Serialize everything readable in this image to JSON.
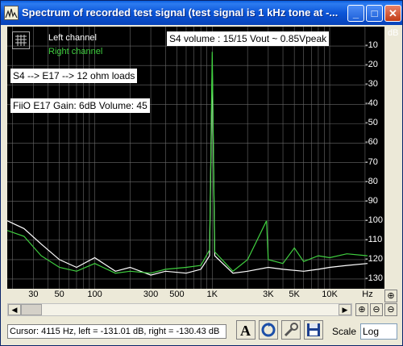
{
  "window": {
    "title": "Spectrum of recorded test signal (test signal is 1 kHz tone at -...",
    "minimize_glyph": "_",
    "maximize_glyph": "□",
    "close_glyph": "✕"
  },
  "legend": {
    "left": "Left channel",
    "right": "Right channel"
  },
  "annotations": {
    "volume": "S4 volume :     15/15     Vout ~ 0.85Vpeak",
    "chain": "S4 --> E17 --> 12 ohm loads",
    "settings": "FiiO E17   Gain: 6dB   Volume: 45"
  },
  "y_unit": "dB",
  "x_unit": "Hz",
  "status": {
    "cursor": "Cursor:  4115 Hz,  left = -131.01 dB,  right = -130.43 dB"
  },
  "scale": {
    "label": "Scale",
    "value": "Log"
  },
  "tool_icons": [
    "text-tool-icon",
    "refresh-icon",
    "wrench-icon",
    "save-disk-icon"
  ],
  "colors": {
    "left": "#ffffff",
    "right": "#40d040",
    "background": "#000000",
    "grid": "#6a6a6a"
  },
  "chart_data": {
    "type": "line",
    "x_scale": "log",
    "x_ticks": [
      "30",
      "50",
      "100",
      "300",
      "500",
      "1K",
      "3K",
      "5K",
      "10K",
      "Hz"
    ],
    "y_ticks": [
      "dB",
      "-10",
      "-20",
      "-30",
      "-40",
      "-50",
      "-60",
      "-70",
      "-80",
      "-90",
      "-100",
      "-110",
      "-120",
      "-130"
    ],
    "ylim": [
      -135,
      0
    ],
    "xlim": [
      18,
      21000
    ],
    "series": [
      {
        "name": "Left channel",
        "color": "#ffffff",
        "points": [
          [
            18,
            -100
          ],
          [
            25,
            -104
          ],
          [
            35,
            -112
          ],
          [
            50,
            -120
          ],
          [
            70,
            -124
          ],
          [
            100,
            -119
          ],
          [
            150,
            -126
          ],
          [
            200,
            -124
          ],
          [
            300,
            -128
          ],
          [
            400,
            -126
          ],
          [
            600,
            -127
          ],
          [
            800,
            -125
          ],
          [
            950,
            -118
          ],
          [
            1000,
            -20
          ],
          [
            1050,
            -118
          ],
          [
            1500,
            -127
          ],
          [
            2000,
            -126
          ],
          [
            3000,
            -124
          ],
          [
            4000,
            -125
          ],
          [
            6000,
            -126
          ],
          [
            8000,
            -125
          ],
          [
            10000,
            -124
          ],
          [
            14000,
            -123
          ],
          [
            21000,
            -122
          ]
        ]
      },
      {
        "name": "Right channel",
        "color": "#40d040",
        "points": [
          [
            18,
            -105
          ],
          [
            25,
            -108
          ],
          [
            35,
            -118
          ],
          [
            50,
            -124
          ],
          [
            70,
            -126
          ],
          [
            100,
            -122
          ],
          [
            150,
            -127
          ],
          [
            200,
            -126
          ],
          [
            300,
            -127
          ],
          [
            400,
            -125
          ],
          [
            600,
            -124
          ],
          [
            800,
            -123
          ],
          [
            950,
            -115
          ],
          [
            1000,
            -13
          ],
          [
            1050,
            -116
          ],
          [
            1500,
            -126
          ],
          [
            2000,
            -120
          ],
          [
            2900,
            -100
          ],
          [
            3000,
            -120
          ],
          [
            4000,
            -122
          ],
          [
            5000,
            -114
          ],
          [
            6000,
            -121
          ],
          [
            8000,
            -118
          ],
          [
            10000,
            -119
          ],
          [
            14000,
            -117
          ],
          [
            21000,
            -118
          ]
        ]
      }
    ]
  }
}
